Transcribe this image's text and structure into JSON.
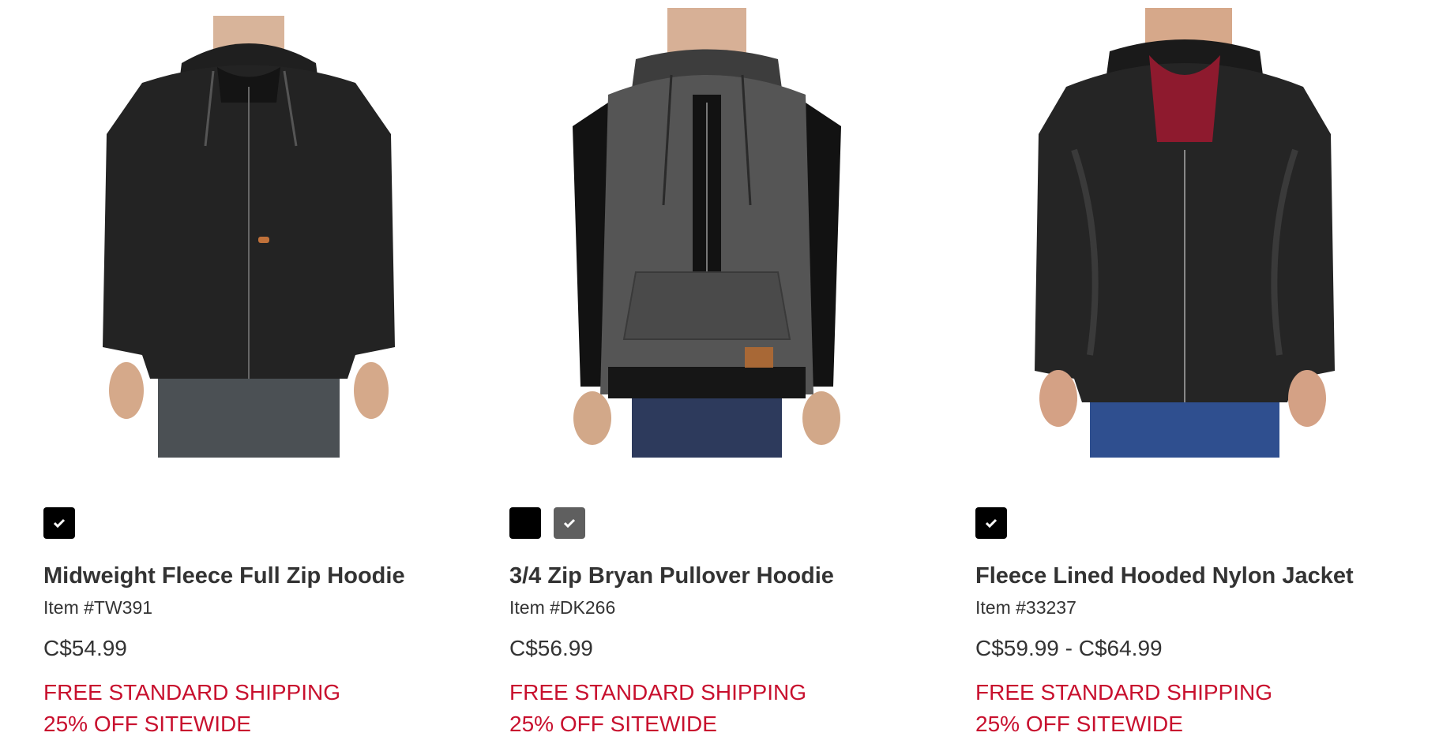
{
  "products": [
    {
      "name": "Midweight Fleece Full Zip Hoodie",
      "item_number": "Item #TW391",
      "price": "C$54.99",
      "promos": [
        "FREE STANDARD SHIPPING",
        "25% OFF SITEWIDE"
      ],
      "swatches": [
        {
          "color": "#000000",
          "selected": true
        }
      ],
      "image": {
        "description_icon": "hoodie-full-zip-image",
        "body_color": "#222222"
      }
    },
    {
      "name": "3/4 Zip Bryan Pullover Hoodie",
      "item_number": "Item #DK266",
      "price": "C$56.99",
      "promos": [
        "FREE STANDARD SHIPPING",
        "25% OFF SITEWIDE"
      ],
      "swatches": [
        {
          "color": "#000000",
          "selected": false
        },
        {
          "color": "#5f5f5f",
          "selected": true
        }
      ],
      "image": {
        "description_icon": "pullover-hoodie-image",
        "body_color": "#4a4a4a"
      }
    },
    {
      "name": "Fleece Lined Hooded Nylon Jacket",
      "item_number": "Item #33237",
      "price": "C$59.99 - C$64.99",
      "promos": [
        "FREE STANDARD SHIPPING",
        "25% OFF SITEWIDE"
      ],
      "swatches": [
        {
          "color": "#000000",
          "selected": true
        }
      ],
      "image": {
        "description_icon": "nylon-jacket-image",
        "body_color": "#1e1e1e"
      }
    }
  ],
  "colors": {
    "promo": "#c8102e",
    "text": "#333333"
  }
}
